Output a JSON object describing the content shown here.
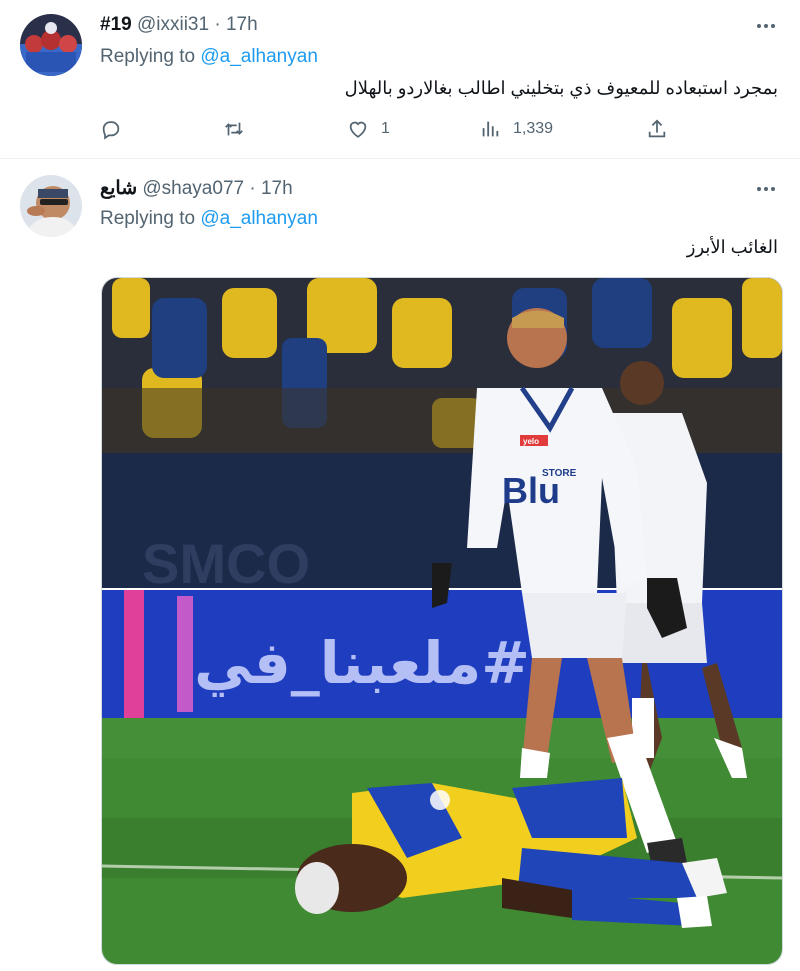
{
  "tweets": [
    {
      "name": "#19",
      "handle": "@ixxii31",
      "dot": "·",
      "time": "17h",
      "reply_prefix": "Replying to ",
      "reply_mention": "@a_alhanyan",
      "text": "بمجرد استبعاده للمعيوف ذي بتخليني اطالب بغالاردو بالهلال",
      "stats": {
        "reply": "",
        "retweet": "",
        "like": "1",
        "views": "1,339"
      }
    },
    {
      "name": "شايع",
      "handle": "@shaya077",
      "dot": "·",
      "time": "17h",
      "reply_prefix": "Replying to ",
      "reply_mention": "@a_alhanyan",
      "text": "الغائب الأبرز",
      "media": {
        "banner_text": "#ملعبنا_في",
        "stadium_board": "SMCO",
        "jersey_sponsor": "Blu",
        "jersey_store": "STORE",
        "brand_badge": "yelo"
      }
    }
  ],
  "colors": {
    "accent": "#1d9bf0",
    "muted": "#536471",
    "text": "#0f1419"
  },
  "icons": [
    "more-icon",
    "reply-icon",
    "retweet-icon",
    "like-icon",
    "views-icon",
    "share-icon"
  ]
}
